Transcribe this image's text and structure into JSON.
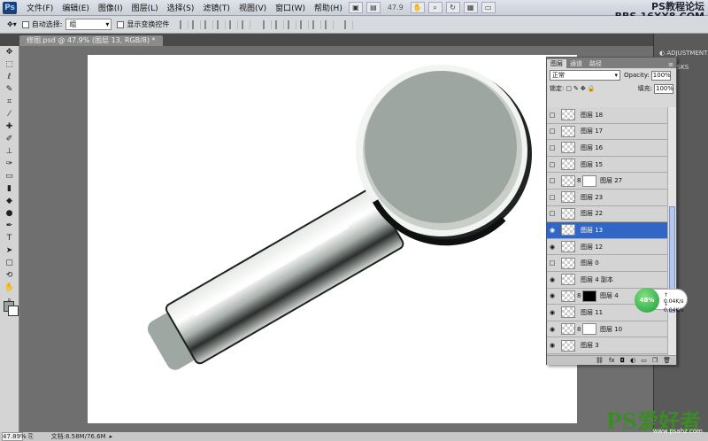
{
  "menubar": {
    "logo": "Ps",
    "items": [
      "文件(F)",
      "编辑(E)",
      "图像(I)",
      "图层(L)",
      "选择(S)",
      "滤镜(T)",
      "视图(V)",
      "窗口(W)",
      "帮助(H)"
    ],
    "zoom": "47.9"
  },
  "options": {
    "auto_select_label": "自动选择:",
    "auto_select_value": "组",
    "transform_label": "显示变换控件"
  },
  "document": {
    "tab_title": "修图.psd @ 47.9% (图层 13, RGB/8) *",
    "zoom_status": "47.89%",
    "doc_info": "文档:8.58M/76.6M"
  },
  "watermark": {
    "top_line1": "PS教程论坛",
    "top_line2": "BBS.16XX8.COM",
    "bottom_logo": "PS爱好者",
    "bottom_url": "www.psahz.com"
  },
  "dock": {
    "adjustments": "ADJUSTMENTS",
    "masks": "MASKS"
  },
  "layers_panel": {
    "tabs": [
      "图层",
      "通道",
      "路径"
    ],
    "blend_mode": "正常",
    "opacity_label": "Opacity:",
    "opacity_value": "100%",
    "lock_label": "锁定:",
    "fill_label": "填充:",
    "fill_value": "100%",
    "layers": [
      {
        "name": "图层 18",
        "visible": false,
        "mask": ""
      },
      {
        "name": "图层 17",
        "visible": false,
        "mask": ""
      },
      {
        "name": "图层 16",
        "visible": false,
        "mask": ""
      },
      {
        "name": "图层 15",
        "visible": false,
        "mask": ""
      },
      {
        "name": "图层 27",
        "visible": false,
        "mask": "white"
      },
      {
        "name": "图层 23",
        "visible": false,
        "mask": ""
      },
      {
        "name": "图层 22",
        "visible": false,
        "mask": ""
      },
      {
        "name": "图层 13",
        "visible": true,
        "mask": "",
        "selected": true
      },
      {
        "name": "图层 12",
        "visible": true,
        "mask": ""
      },
      {
        "name": "图层 0",
        "visible": false,
        "mask": ""
      },
      {
        "name": "图层 4 副本",
        "visible": true,
        "mask": ""
      },
      {
        "name": "图层 4",
        "visible": true,
        "mask": "black"
      },
      {
        "name": "图层 11",
        "visible": true,
        "mask": ""
      },
      {
        "name": "图层 10",
        "visible": true,
        "mask": "white"
      },
      {
        "name": "图层 3",
        "visible": true,
        "mask": ""
      }
    ]
  },
  "net_widget": {
    "percent": "48%",
    "up": "0.04K/s",
    "down": "0.04K/s"
  }
}
